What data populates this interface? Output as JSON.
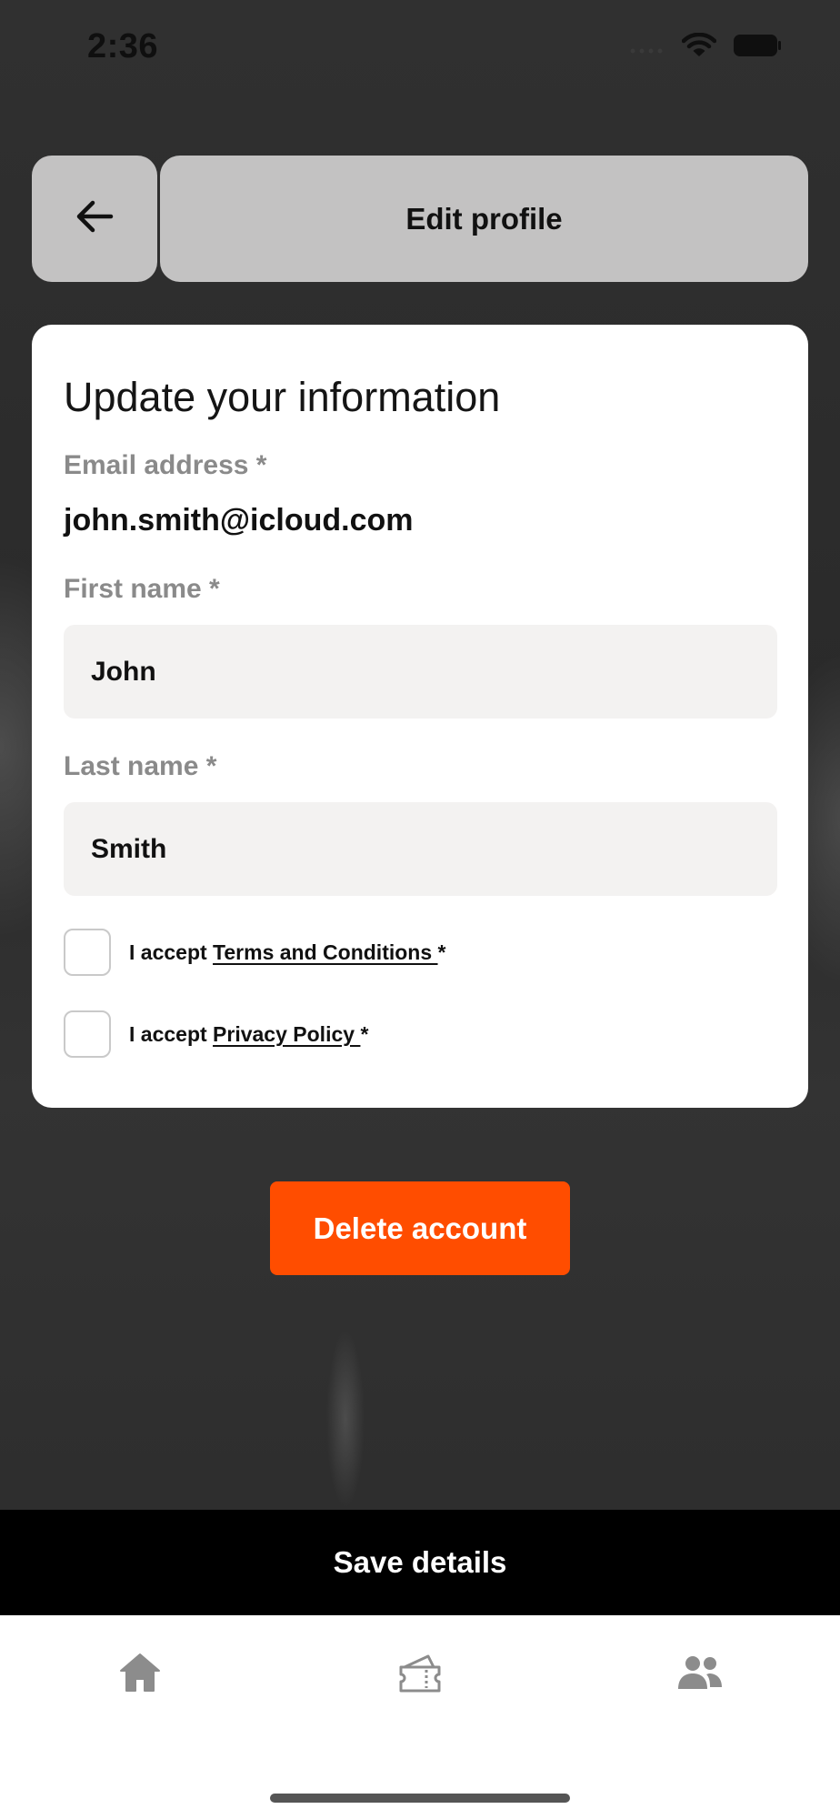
{
  "status_bar": {
    "time": "2:36",
    "wifi_icon": "wifi-icon",
    "battery_icon": "battery-icon"
  },
  "header": {
    "back_icon": "arrow-left-icon",
    "title": "Edit profile"
  },
  "form": {
    "heading": "Update your information",
    "email_label": "Email address *",
    "email_value": "john.smith@icloud.com",
    "first_name_label": "First name *",
    "first_name_value": "John",
    "last_name_label": "Last name *",
    "last_name_value": "Smith",
    "terms": {
      "prefix": "I accept ",
      "link": "Terms and Conditions ",
      "suffix": "*",
      "checked": false
    },
    "privacy": {
      "prefix": "I accept ",
      "link": "Privacy Policy ",
      "suffix": "*",
      "checked": false
    }
  },
  "actions": {
    "delete_label": "Delete account",
    "save_label": "Save details"
  },
  "tab_bar": {
    "items": [
      {
        "icon": "home-icon"
      },
      {
        "icon": "ticket-icon"
      },
      {
        "icon": "users-icon"
      }
    ]
  },
  "colors": {
    "accent": "#ff4d00",
    "header_bg": "#c3c2c2",
    "save_bar": "#000000",
    "tab_icon": "#8c8c8c"
  }
}
